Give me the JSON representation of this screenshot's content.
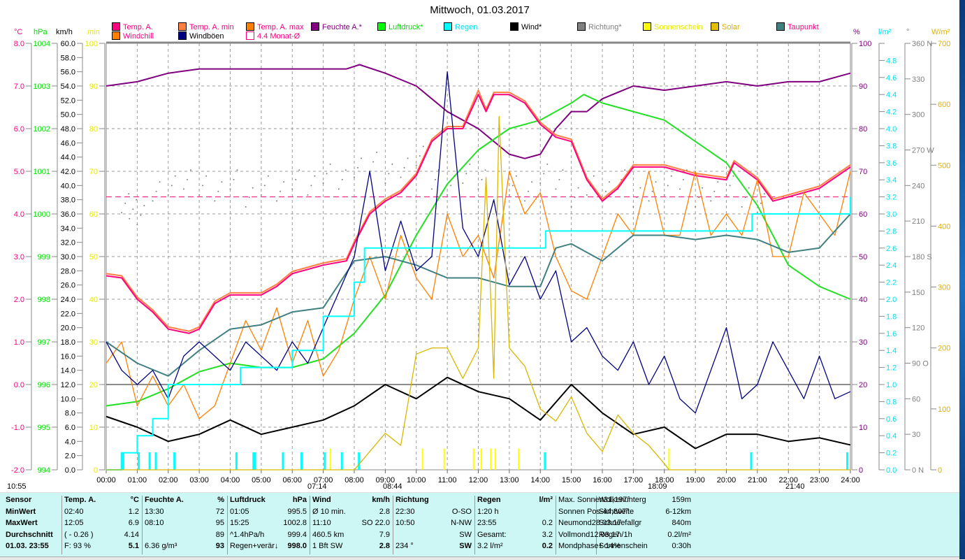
{
  "title": "Mittwoch, 01.03.2017",
  "legend": [
    {
      "label": "Temp. A.",
      "color": "#ff0080",
      "text": "#ff0080"
    },
    {
      "label": "Temp. A. min",
      "color": "#ff8040",
      "text": "#ff0080"
    },
    {
      "label": "Temp. A. max",
      "color": "#ff8000",
      "text": "#ff0080"
    },
    {
      "label": "Feuchte A.*",
      "color": "#800080",
      "text": "#800080"
    },
    {
      "label": "Luftdruck*",
      "color": "#00ff00",
      "text": "#00dd00"
    },
    {
      "label": "Regen",
      "color": "#00ffff",
      "text": "#00e0f0"
    },
    {
      "label": "Wind*",
      "color": "#000000",
      "text": "#000000"
    },
    {
      "label": "Richtung*",
      "color": "#808080",
      "text": "#808080"
    },
    {
      "label": "Sonnenschein",
      "color": "#ffff00",
      "text": "#e8e800"
    },
    {
      "label": "Solar",
      "color": "#e0c000",
      "text": "#e0b000"
    },
    {
      "label": "Taupunkt",
      "color": "#408080",
      "text": "#ff0080"
    },
    {
      "label": "Windchill",
      "color": "#ff8000",
      "text": "#ff0080"
    },
    {
      "label": "Windböen",
      "color": "#000080",
      "text": "#000000"
    },
    {
      "label": "4.4 Monat-Ø",
      "color": "#ffffff",
      "text": "#ff0080"
    }
  ],
  "units": {
    "c": "°C",
    "hpa": "hPa",
    "kmh": "km/h",
    "min": "min",
    "pct": "%",
    "rain": "l/m²",
    "deg": "°",
    "wm2": "W/m²"
  },
  "markers": {
    "left": "10:55",
    "sunrise": "07:14",
    "m2": "08:44",
    "sunset": "18:09",
    "m4": "21:40"
  },
  "chart_data": {
    "type": "line",
    "title": "Mittwoch, 01.03.2017",
    "xlabel": "",
    "x_ticks": [
      "00:00",
      "01:00",
      "02:00",
      "03:00",
      "04:00",
      "05:00",
      "06:00",
      "07:00",
      "08:00",
      "09:00",
      "10:00",
      "11:00",
      "12:00",
      "13:00",
      "14:00",
      "15:00",
      "16:00",
      "17:00",
      "18:00",
      "19:00",
      "20:00",
      "21:00",
      "22:00",
      "23:00",
      "24:00"
    ],
    "axes": {
      "c": {
        "range": [
          -2,
          8
        ],
        "ticks": [
          "8.0",
          "7.0",
          "6.0",
          "5.0",
          "4.0",
          "3.0",
          "2.0",
          "1.0",
          "0.0",
          "-1.0",
          "-2.0"
        ]
      },
      "hpa": {
        "range": [
          994,
          1004
        ],
        "ticks": [
          "1004",
          "1003",
          "1002",
          "1001",
          "1000",
          "999",
          "998",
          "997",
          "996",
          "995",
          "994"
        ]
      },
      "kmh": {
        "range": [
          0,
          60
        ],
        "step": 2
      },
      "min": {
        "range": [
          0,
          100
        ],
        "ticks": [
          "100",
          "90",
          "80",
          "70",
          "60",
          "50",
          "40",
          "30",
          "20",
          "10",
          "0"
        ]
      },
      "pct": {
        "range": [
          0,
          100
        ],
        "ticks": [
          "100",
          "90",
          "80",
          "70",
          "60",
          "50",
          "40",
          "30",
          "20",
          "10",
          "0"
        ]
      },
      "rain": {
        "range": [
          0,
          5
        ],
        "step": 0.2
      },
      "deg": {
        "range": [
          0,
          360
        ],
        "ticks": [
          "360 N",
          "330",
          "300",
          "270 W",
          "240",
          "210",
          "180 S",
          "150",
          "120",
          "90 O",
          "60",
          "30",
          "0 N"
        ]
      },
      "wm2": {
        "range": [
          0,
          700
        ],
        "ticks": [
          "700",
          "600",
          "500",
          "400",
          "300",
          "200",
          "100",
          "0"
        ]
      }
    },
    "monat_avg": 4.4,
    "series": [
      {
        "name": "Feuchte A.",
        "axis": "pct",
        "color": "#800080",
        "x": [
          0,
          1,
          2,
          3,
          5,
          7.75,
          8.17,
          9,
          10,
          11,
          12,
          13,
          13.5,
          14,
          14.5,
          15,
          15.5,
          16,
          17,
          18,
          19,
          20,
          21,
          22,
          23,
          24
        ],
        "y": [
          90,
          91,
          93,
          94,
          94,
          94,
          95,
          93,
          90,
          84,
          80,
          74,
          73,
          74,
          80,
          84,
          84,
          87,
          90,
          89,
          90,
          91,
          90,
          91,
          91,
          93
        ]
      },
      {
        "name": "Luftdruck",
        "axis": "hpa",
        "color": "#22e022",
        "x": [
          0,
          1,
          2,
          3,
          4,
          5,
          6,
          7,
          8,
          9,
          10,
          11,
          12,
          13,
          14,
          15,
          15.4,
          16,
          17,
          18,
          19,
          20,
          21,
          22,
          23,
          24
        ],
        "y": [
          995.5,
          995.6,
          995.9,
          996.3,
          996.5,
          996.4,
          996.4,
          996.6,
          997.2,
          998.1,
          999.5,
          1000.7,
          1001.5,
          1002,
          1002.2,
          1002.6,
          1002.8,
          1002.6,
          1002.4,
          1002.2,
          1001.7,
          1001.2,
          1000.2,
          998.8,
          998.3,
          998.0
        ]
      },
      {
        "name": "Temp. A. max",
        "axis": "c",
        "color": "#ff8040",
        "x": [
          0,
          0.5,
          1,
          1.5,
          2,
          2.67,
          3,
          3.5,
          4,
          5,
          5.5,
          6,
          6.5,
          7,
          7.75,
          8,
          8.5,
          9,
          9.5,
          10,
          10.5,
          11,
          11.5,
          12,
          12.25,
          12.5,
          13,
          13.5,
          14,
          14.5,
          15,
          15.5,
          16,
          16.5,
          17,
          18,
          19,
          20,
          20.25,
          21,
          21.5,
          22,
          23,
          24
        ],
        "y": [
          2.6,
          2.55,
          2.05,
          1.75,
          1.35,
          1.25,
          1.35,
          1.95,
          2.15,
          2.15,
          2.35,
          2.65,
          2.75,
          2.85,
          2.95,
          3.35,
          4.05,
          4.35,
          4.55,
          4.95,
          5.75,
          6.05,
          6.05,
          6.9,
          6.45,
          6.85,
          6.85,
          6.65,
          6.15,
          5.85,
          5.75,
          4.85,
          4.35,
          4.65,
          5.15,
          5.15,
          4.95,
          4.85,
          5.25,
          4.85,
          4.35,
          4.45,
          4.65,
          5.15
        ]
      },
      {
        "name": "Temp. A.",
        "axis": "c",
        "color": "#ff0080",
        "x": [
          0,
          0.5,
          1,
          1.5,
          2,
          2.67,
          3,
          3.5,
          4,
          5,
          5.5,
          6,
          6.5,
          7,
          7.75,
          8,
          8.5,
          9,
          9.5,
          10,
          10.5,
          11,
          11.5,
          12,
          12.25,
          12.5,
          13,
          13.5,
          14,
          14.5,
          15,
          15.5,
          16,
          16.5,
          17,
          18,
          19,
          20,
          20.25,
          21,
          21.5,
          22,
          23,
          24
        ],
        "y": [
          2.55,
          2.5,
          2.0,
          1.7,
          1.3,
          1.2,
          1.3,
          1.9,
          2.1,
          2.1,
          2.3,
          2.6,
          2.7,
          2.8,
          2.9,
          3.3,
          4.0,
          4.3,
          4.5,
          4.9,
          5.7,
          6.0,
          6.0,
          6.8,
          6.4,
          6.8,
          6.8,
          6.6,
          6.1,
          5.8,
          5.7,
          4.8,
          4.3,
          4.6,
          5.1,
          5.1,
          4.9,
          4.8,
          5.2,
          4.8,
          4.3,
          4.4,
          4.6,
          5.1
        ]
      },
      {
        "name": "Windchill",
        "axis": "c",
        "color": "#ff8000",
        "x": [
          0,
          0.5,
          1,
          1.5,
          2,
          2.5,
          3,
          3.5,
          4,
          4.5,
          5,
          5.5,
          6,
          6.5,
          7,
          7.5,
          8,
          8.5,
          9,
          9.5,
          10,
          10.5,
          11,
          11.5,
          12,
          12.5,
          13,
          13.5,
          14,
          14.5,
          15,
          15.5,
          16,
          16.5,
          17,
          17.5,
          18,
          18.5,
          19,
          19.5,
          20,
          20.5,
          21,
          21.5,
          22,
          22.5,
          23,
          23.5,
          24
        ],
        "y": [
          0.5,
          1.0,
          -0.5,
          0.2,
          -0.5,
          0.0,
          -0.8,
          -0.5,
          0.5,
          1.5,
          0.8,
          1.8,
          0.5,
          1.5,
          0.2,
          0.8,
          2.0,
          3.0,
          2.0,
          3.5,
          2.5,
          2.0,
          4.0,
          3.0,
          3.5,
          2.5,
          5.0,
          4.0,
          4.5,
          3.0,
          2.2,
          2.0,
          3.0,
          4.0,
          3.5,
          5.0,
          3.5,
          3.5,
          5.0,
          3.5,
          4.0,
          3.5,
          4.8,
          3.0,
          3.0,
          4.5,
          4.0,
          3.5,
          5.0
        ]
      },
      {
        "name": "Taupunkt",
        "axis": "c",
        "color": "#408080",
        "x": [
          0,
          1,
          2,
          3,
          4,
          5,
          6,
          7,
          8,
          9,
          10,
          11,
          12,
          13,
          14,
          14.5,
          15,
          16,
          17,
          18,
          19,
          20,
          21,
          22,
          23,
          24
        ],
        "y": [
          1.0,
          0.5,
          0.2,
          0.8,
          1.3,
          1.4,
          1.7,
          1.8,
          2.9,
          3.0,
          2.8,
          2.5,
          2.5,
          2.3,
          2.3,
          3.2,
          3.3,
          2.9,
          3.5,
          3.5,
          3.4,
          3.5,
          3.4,
          3.1,
          3.2,
          4.0
        ]
      },
      {
        "name": "Windböen",
        "axis": "kmh",
        "color": "#000080",
        "x": [
          0,
          0.5,
          1,
          1.5,
          2,
          2.5,
          3,
          3.5,
          4,
          4.5,
          5,
          5.5,
          6,
          6.5,
          7,
          7.5,
          8,
          8.5,
          9,
          9.5,
          10,
          10.5,
          11,
          11.5,
          12,
          12.5,
          13,
          13.5,
          14,
          14.5,
          15,
          15.5,
          16,
          16.5,
          17,
          17.5,
          18,
          18.5,
          19,
          19.5,
          20,
          20.5,
          21,
          21.5,
          22,
          22.5,
          23,
          23.5,
          24
        ],
        "y": [
          18,
          14,
          12,
          14,
          10,
          16,
          18,
          16,
          14,
          18,
          16,
          14,
          18,
          15,
          20,
          25,
          30,
          42,
          28,
          35,
          28,
          30,
          56,
          34,
          30,
          38,
          26,
          30,
          24,
          28,
          18,
          20,
          16,
          14,
          18,
          12,
          16,
          10,
          8,
          14,
          20,
          10,
          12,
          18,
          14,
          10,
          16,
          10,
          11
        ]
      },
      {
        "name": "Wind",
        "axis": "kmh",
        "color": "#000000",
        "x": [
          0,
          1,
          2,
          3,
          4,
          5,
          6,
          7,
          8,
          9,
          10,
          11,
          12,
          13,
          14,
          15,
          16,
          17,
          18,
          19,
          20,
          21,
          22,
          23,
          24
        ],
        "y": [
          7.5,
          6,
          4,
          5,
          7,
          5,
          6,
          7,
          9,
          12,
          10,
          13,
          11,
          10,
          7,
          12,
          8,
          5,
          6,
          3,
          5,
          5,
          4,
          4.5,
          3.5
        ]
      },
      {
        "name": "Regen",
        "axis": "rain",
        "color": "#00ffff",
        "step": true,
        "x": [
          0,
          0.5,
          1,
          1.5,
          2,
          4.33,
          6,
          7,
          8,
          8.33,
          14.17,
          20.83,
          24
        ],
        "y": [
          0,
          0.2,
          0.4,
          0.6,
          1.0,
          1.2,
          1.4,
          1.8,
          2.2,
          2.6,
          2.8,
          3.0,
          3.2
        ]
      },
      {
        "name": "Solar",
        "axis": "wm2",
        "color": "#d8b800",
        "x": [
          0,
          8,
          8.5,
          9,
          9.5,
          10,
          10.5,
          11,
          11.5,
          12,
          12.25,
          12.5,
          12.67,
          13,
          13.5,
          14,
          14.5,
          15,
          15.5,
          16,
          16.5,
          17,
          17.5,
          18,
          18.15,
          24
        ],
        "y": [
          0,
          0,
          30,
          60,
          40,
          190,
          200,
          200,
          150,
          200,
          480,
          150,
          580,
          200,
          170,
          100,
          80,
          120,
          60,
          30,
          90,
          60,
          40,
          10,
          0,
          0
        ]
      }
    ],
    "richtung": {
      "x": [
        0.5,
        0.75,
        1,
        1.5,
        2,
        2.5,
        3,
        3.5,
        4,
        4.5,
        5,
        5.5,
        6,
        6.5,
        7,
        7.5,
        8,
        8.5,
        9,
        9.5,
        10,
        10.5,
        11,
        11.5,
        12,
        13,
        13.5,
        14,
        14.5,
        15,
        15.5,
        16,
        16.5,
        17,
        17.5,
        18,
        18.5,
        19,
        19.5,
        20,
        20.5,
        21
      ],
      "y": [
        225,
        220,
        215,
        235,
        240,
        245,
        240,
        235,
        245,
        230,
        240,
        235,
        245,
        240,
        250,
        245,
        255,
        260,
        250,
        255,
        265,
        245,
        240,
        250,
        245,
        240,
        235,
        250,
        245,
        230,
        240,
        235,
        245,
        230,
        235,
        240,
        245,
        230,
        235,
        240,
        230,
        225
      ]
    },
    "sonnenschein_bars": {
      "x": [
        7.23,
        10.2,
        10.9,
        11.85,
        12.1,
        12.4,
        12.55,
        13.3,
        18.15
      ],
      "y": [
        5,
        5,
        5,
        5,
        5,
        5,
        5,
        5,
        5
      ]
    },
    "rain_bars": {
      "x": [
        0.5,
        0.55,
        1.05,
        1.4,
        1.6,
        2.2,
        4.2,
        4.75,
        4.8,
        5.7,
        6.3,
        7.05,
        7.6,
        8.15,
        14.15,
        20.8,
        23.9
      ]
    }
  },
  "table": [
    {
      "h": [
        "Sensor",
        ""
      ],
      "rows": [
        [
          "MinWert",
          ""
        ],
        [
          "MaxWert",
          ""
        ],
        [
          "Durchschnitt",
          ""
        ],
        [
          "01.03. 23:55",
          ""
        ]
      ]
    },
    {
      "h": [
        "Temp. A.",
        "°C"
      ],
      "rows": [
        [
          "02:40",
          "1.2"
        ],
        [
          "12:05",
          "6.9"
        ],
        [
          "( - 0.26 )",
          "4.14"
        ],
        [
          "F: 93 %",
          "5.1"
        ]
      ]
    },
    {
      "h": [
        "Feuchte A.",
        "%"
      ],
      "rows": [
        [
          "13:30",
          "72"
        ],
        [
          "08:10",
          "95"
        ],
        [
          "",
          "89"
        ],
        [
          "6.36 g/m³",
          "93"
        ]
      ]
    },
    {
      "h": [
        "Luftdruck",
        "hPa"
      ],
      "rows": [
        [
          "01:05",
          "995.5"
        ],
        [
          "15:25",
          "1002.8"
        ],
        [
          "^1.4hPa/h",
          "999.4"
        ],
        [
          "Regen+verär↓",
          "998.0"
        ]
      ]
    },
    {
      "h": [
        "Wind",
        "km/h"
      ],
      "rows": [
        [
          "Ø 10 min.",
          "2.8"
        ],
        [
          "11:10",
          "SO 22.0"
        ],
        [
          "460.5 km",
          "7.9"
        ],
        [
          "1 Bft SW",
          "2.8"
        ]
      ]
    },
    {
      "h": [
        "Richtung",
        ""
      ],
      "rows": [
        [
          "22:30",
          "O-SO"
        ],
        [
          "10:50",
          "N-NW"
        ],
        [
          "",
          "SW"
        ],
        [
          "234 °",
          "SW"
        ]
      ]
    },
    {
      "h": [
        "Regen",
        "l/m²"
      ],
      "rows": [
        [
          "1:20 h",
          ""
        ],
        [
          "23:55",
          "0.2"
        ],
        [
          "Gesamt:",
          "3.2"
        ],
        [
          "3.2 l/m²",
          "0.2"
        ]
      ]
    },
    {
      "h": [
        "Max. Sonnen",
        "31,197°"
      ],
      "rows": [
        [
          "Sonnen Pos",
          "-44,807°"
        ],
        [
          "Neumond",
          "28.03.17"
        ],
        [
          "Vollmond",
          "12.03.17"
        ],
        [
          "Mondphase",
          "+ 14%"
        ]
      ]
    },
    {
      "h": [
        "Wolkenunterg",
        "159m"
      ],
      "rows": [
        [
          "Sichtweite",
          "6-12km"
        ],
        [
          "Schneefallgr",
          "840m"
        ],
        [
          "Regen/1h",
          "0.2l/m²"
        ],
        [
          "Sonnenschein",
          "0:30h"
        ]
      ]
    }
  ]
}
